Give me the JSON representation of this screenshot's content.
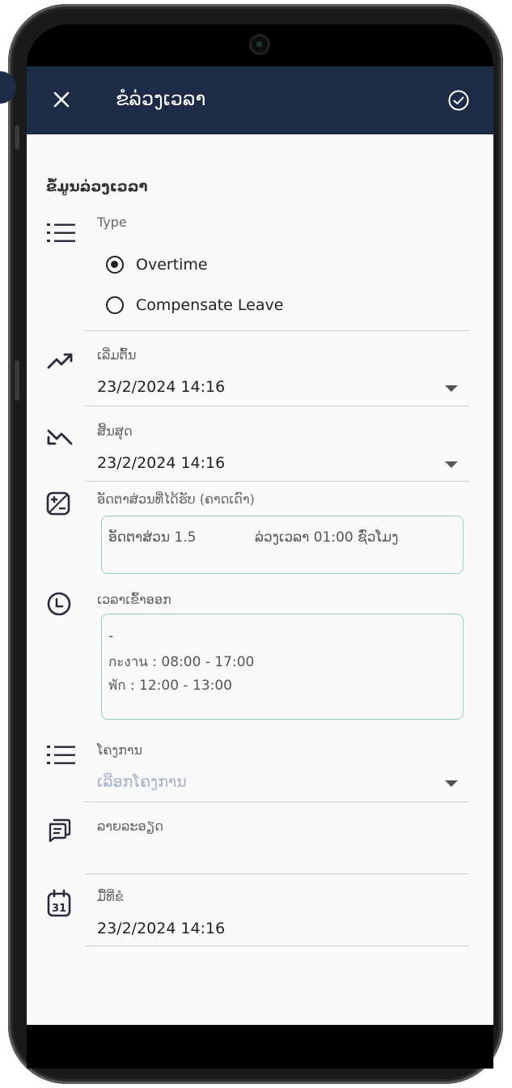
{
  "header": {
    "title": "ຂໍລ່ວງເວລາ"
  },
  "section": {
    "title": "ຂໍ້ມູນລ່ວງເວລາ"
  },
  "type": {
    "label": "Type",
    "options": [
      {
        "label": "Overtime",
        "selected": true
      },
      {
        "label": "Compensate Leave",
        "selected": false
      }
    ]
  },
  "start": {
    "label": "ເລີ່ມຕົ້ນ",
    "value": "23/2/2024 14:16"
  },
  "end": {
    "label": "ສິ້ນສຸດ",
    "value": "23/2/2024 14:16"
  },
  "rate": {
    "label": "ອັດຕາສ່ວນທີ່ໄດ້ຮັບ (ຄາດເດົາ)",
    "rate_text": "ອັດຕາສ່ວນ 1.5",
    "ot_text": "ລ່ວງເວລາ 01:00 ຊົ່ວໂມງ"
  },
  "shift": {
    "label": "ເວລາເຂົ້າອອກ",
    "lines": [
      "-",
      "กะงาน : 08:00 - 17:00",
      "พัก : 12:00 - 13:00"
    ]
  },
  "project": {
    "label": "ໂຄງການ",
    "placeholder": "ເລືອກໂຄງການ"
  },
  "details": {
    "label": "ລາຍລະອຽດ"
  },
  "request_date": {
    "label": "ມື້ທີ່ຂໍ",
    "value": "23/2/2024 14:16"
  },
  "icons": {
    "calendar_day": "31"
  },
  "colors": {
    "appbar": "#1e2b47",
    "box_border": "#8fd4b4"
  }
}
